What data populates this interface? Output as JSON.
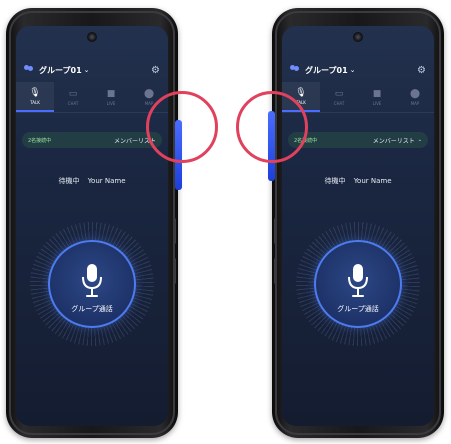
{
  "colors": {
    "accent": "#4a6dff",
    "screen_bg": "#1a2640",
    "highlight_ring": "#e0415d",
    "online_text": "#9be3a0"
  },
  "phones": [
    {
      "header": {
        "group_name": "グループ01",
        "chevron": "⌄"
      },
      "tabs": [
        {
          "label": "TALK",
          "icon": "mic-icon",
          "active": true
        },
        {
          "label": "CHAT",
          "icon": "chat-icon",
          "active": false
        },
        {
          "label": "LIVE",
          "icon": "video-icon",
          "active": false
        },
        {
          "label": "MAP",
          "icon": "pin-icon",
          "active": false
        }
      ],
      "member_bar": {
        "online": "2名接続中",
        "list_label": "メンバーリスト"
      },
      "status": {
        "state": "待機中",
        "user": "Your Name"
      },
      "talk_button": {
        "label": "グループ通話"
      }
    },
    {
      "header": {
        "group_name": "グループ01",
        "chevron": "⌄"
      },
      "tabs": [
        {
          "label": "TALK",
          "icon": "mic-icon",
          "active": true
        },
        {
          "label": "CHAT",
          "icon": "chat-icon",
          "active": false
        },
        {
          "label": "LIVE",
          "icon": "video-icon",
          "active": false
        },
        {
          "label": "MAP",
          "icon": "pin-icon",
          "active": false
        }
      ],
      "member_bar": {
        "online": "2名接続中",
        "list_label": "メンバーリスト",
        "chevron": "⌄"
      },
      "status": {
        "state": "待機中",
        "user": "Your Name"
      },
      "talk_button": {
        "label": "グループ通話"
      }
    }
  ]
}
